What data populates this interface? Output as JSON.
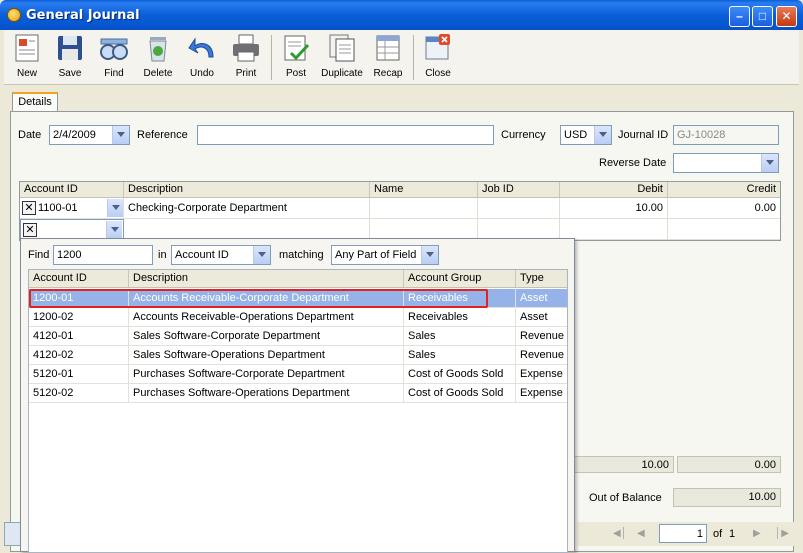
{
  "window": {
    "title": "General Journal"
  },
  "toolbar": {
    "new": "New",
    "save": "Save",
    "find": "Find",
    "delete": "Delete",
    "undo": "Undo",
    "print": "Print",
    "post": "Post",
    "duplicate": "Duplicate",
    "recap": "Recap",
    "close": "Close"
  },
  "tabs": {
    "details": "Details"
  },
  "form": {
    "date_label": "Date",
    "date_value": "2/4/2009",
    "reference_label": "Reference",
    "reference_value": "",
    "currency_label": "Currency",
    "currency_value": "USD",
    "journal_id_label": "Journal ID",
    "journal_id_value": "GJ-10028",
    "reverse_date_label": "Reverse Date",
    "reverse_date_value": ""
  },
  "grid": {
    "headers": [
      "Account ID",
      "Description",
      "Name",
      "Job ID",
      "Debit",
      "Credit"
    ],
    "rows": [
      {
        "account_id": "1100-01",
        "description": "Checking-Corporate Department",
        "name": "",
        "job_id": "",
        "debit": "10.00",
        "credit": "0.00"
      },
      {
        "account_id": "",
        "description": "",
        "name": "",
        "job_id": "",
        "debit": "",
        "credit": ""
      }
    ]
  },
  "totals": {
    "debit": "10.00",
    "credit": "0.00",
    "out_of_balance_label": "Out of Balance",
    "out_of_balance_value": "10.00"
  },
  "popup": {
    "find_label": "Find",
    "find_value": "1200",
    "in_label": "in",
    "in_value": "Account ID",
    "matching_label": "matching",
    "matching_value": "Any Part of Field",
    "headers": [
      "Account ID",
      "Description",
      "Account Group",
      "Type"
    ],
    "rows": [
      {
        "account_id": "1200-01",
        "description": "Accounts Receivable-Corporate Department",
        "group": "Receivables",
        "type": "Asset"
      },
      {
        "account_id": "1200-02",
        "description": "Accounts Receivable-Operations Department",
        "group": "Receivables",
        "type": "Asset"
      },
      {
        "account_id": "4120-01",
        "description": "Sales Software-Corporate Department",
        "group": "Sales",
        "type": "Revenue"
      },
      {
        "account_id": "4120-02",
        "description": "Sales Software-Operations Department",
        "group": "Sales",
        "type": "Revenue"
      },
      {
        "account_id": "5120-01",
        "description": "Purchases Software-Corporate Department",
        "group": "Cost of Goods Sold",
        "type": "Expense"
      },
      {
        "account_id": "5120-02",
        "description": "Purchases Software-Operations Department",
        "group": "Cost of Goods Sold",
        "type": "Expense"
      }
    ]
  },
  "pager": {
    "page_value": "1",
    "of_label": "of",
    "total_pages": "1"
  },
  "icons": [
    "app-icon",
    "new-icon",
    "save-icon",
    "find-icon",
    "delete-icon",
    "undo-icon",
    "print-icon",
    "post-icon",
    "duplicate-icon",
    "recap-icon",
    "close-icon"
  ]
}
